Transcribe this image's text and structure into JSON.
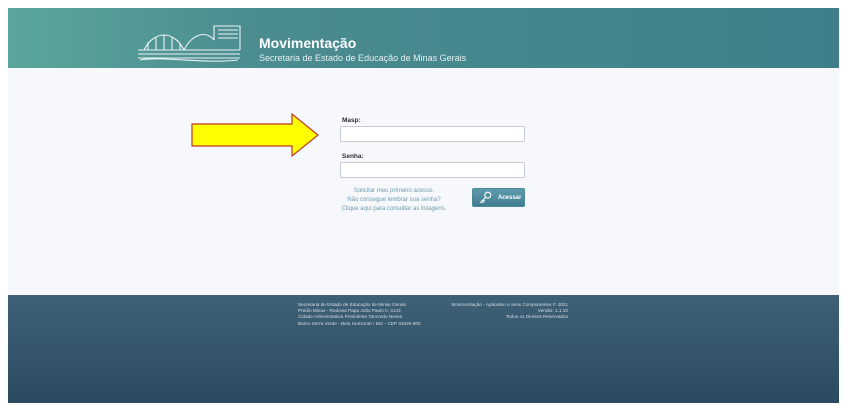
{
  "header": {
    "title": "Movimentação",
    "subtitle": "Secretaria de Estado de Educação de Minas Gerais",
    "logo_icon": "building-logo-icon"
  },
  "login": {
    "masp_label": "Masp:",
    "masp_value": "",
    "senha_label": "Senha:",
    "senha_value": "",
    "links": {
      "first_access": "Solicitar meu primeiro acesso.",
      "forgot_password": "Não consegue lembrar sua senha?",
      "listing": "Clique aqui para consultar as listagens."
    },
    "access_button": {
      "label": "Acessar",
      "icon": "key-icon"
    }
  },
  "annotation": {
    "arrow_icon": "yellow-arrow-icon",
    "arrow_color": "#ffff00"
  },
  "footer": {
    "left": [
      "Secretaria de Estado de Educação de Minas Gerais",
      "Prédio Minas - Rodovia Papa João Paulo II, 4143",
      "Cidade Administrativa Presidente Tancredo Neves",
      "Bairro Serra Verde - Belo Horizonte / MG - CEP 31630-900"
    ],
    "right": [
      "Movimentação - Aplicativo e seus Componentes © 2021",
      "Versão: 1.1.10",
      "Todos os Direitos Reservados"
    ]
  },
  "colors": {
    "header": "#4b8c90",
    "footer": "#2b4a60",
    "button": "#4b8a9a",
    "link": "#6e9cab"
  }
}
